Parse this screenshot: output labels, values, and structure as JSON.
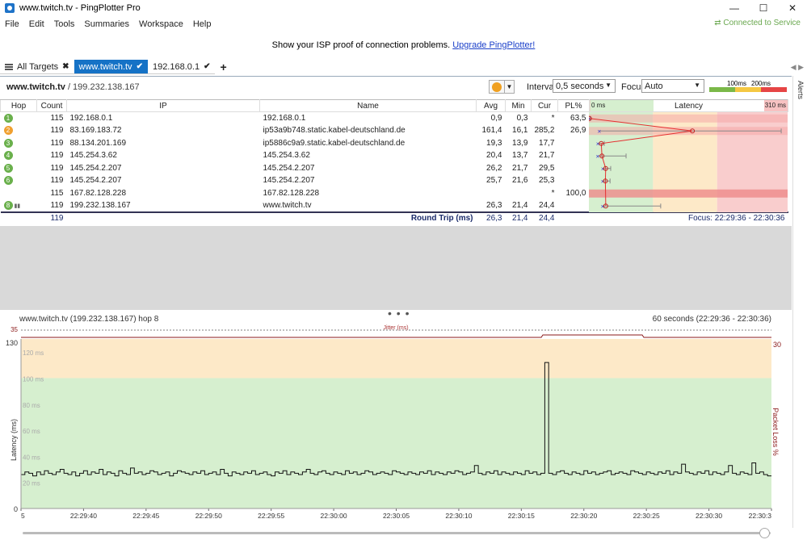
{
  "window": {
    "title": "www.twitch.tv - PingPlotter Pro"
  },
  "menu": [
    "File",
    "Edit",
    "Tools",
    "Summaries",
    "Workspace",
    "Help"
  ],
  "status": {
    "connected": "Connected to Service"
  },
  "promo": {
    "text": "Show your ISP proof of connection problems.",
    "link": "Upgrade PingPlotter!"
  },
  "tabs": [
    {
      "label": "All Targets",
      "mark": "✖"
    },
    {
      "label": "www.twitch.tv",
      "mark": "✔"
    },
    {
      "label": "192.168.0.1",
      "mark": "✔"
    }
  ],
  "target": {
    "name": "www.twitch.tv",
    "ip": " / 199.232.138.167"
  },
  "controls": {
    "interval_label": "Interval",
    "interval_value": "0,5 seconds",
    "focus_label": "Focus",
    "focus_value": "Auto",
    "legend_100": "100ms",
    "legend_200": "200ms",
    "alerts": "Alerts"
  },
  "columns": {
    "hop": "Hop",
    "count": "Count",
    "ip": "IP",
    "name": "Name",
    "avg": "Avg",
    "min": "Min",
    "cur": "Cur",
    "pl": "PL%",
    "latency": "Latency",
    "lat_min": "0 ms",
    "lat_max": "310 ms"
  },
  "hops": [
    {
      "hop": "1",
      "color": "#6ab04c",
      "count": "115",
      "ip": "192.168.0.1",
      "name": "192.168.0.1",
      "avg": "0,9",
      "min": "0,3",
      "cur": "*",
      "pl": "63,5",
      "avg_ms": 0.9,
      "min_ms": 0.3,
      "max_ms": 2,
      "loss": 63.5
    },
    {
      "hop": "2",
      "color": "#f0a030",
      "count": "119",
      "ip": "83.169.183.72",
      "name": "ip53a9b748.static.kabel-deutschland.de",
      "avg": "161,4",
      "min": "16,1",
      "cur": "285,2",
      "pl": "26,9",
      "avg_ms": 161.4,
      "min_ms": 16.1,
      "max_ms": 300,
      "loss": 26.9
    },
    {
      "hop": "3",
      "color": "#6ab04c",
      "count": "119",
      "ip": "88.134.201.169",
      "name": "ip5886c9a9.static.kabel-deutschland.de",
      "avg": "19,3",
      "min": "13,9",
      "cur": "17,7",
      "pl": "",
      "avg_ms": 19.3,
      "min_ms": 13.9,
      "max_ms": 24,
      "loss": 0
    },
    {
      "hop": "4",
      "color": "#6ab04c",
      "count": "119",
      "ip": "145.254.3.62",
      "name": "145.254.3.62",
      "avg": "20,4",
      "min": "13,7",
      "cur": "21,7",
      "pl": "",
      "avg_ms": 20.4,
      "min_ms": 13.7,
      "max_ms": 58,
      "loss": 0
    },
    {
      "hop": "5",
      "color": "#6ab04c",
      "count": "119",
      "ip": "145.254.2.207",
      "name": "145.254.2.207",
      "avg": "26,2",
      "min": "21,7",
      "cur": "29,5",
      "pl": "",
      "avg_ms": 26.2,
      "min_ms": 21.7,
      "max_ms": 34,
      "loss": 0
    },
    {
      "hop": "6",
      "color": "#6ab04c",
      "count": "119",
      "ip": "145.254.2.207",
      "name": "145.254.2.207",
      "avg": "25,7",
      "min": "21,6",
      "cur": "25,3",
      "pl": "",
      "avg_ms": 25.7,
      "min_ms": 21.6,
      "max_ms": 33,
      "loss": 0
    },
    {
      "hop": "",
      "color": "",
      "count": "115",
      "ip": "167.82.128.228",
      "name": "167.82.128.228",
      "avg": "",
      "min": "",
      "cur": "*",
      "pl": "100,0",
      "avg_ms": null,
      "min_ms": null,
      "max_ms": null,
      "loss": 100
    },
    {
      "hop": "8",
      "color": "#6ab04c",
      "count": "119",
      "ip": "199.232.138.167",
      "name": "www.twitch.tv",
      "avg": "26,3",
      "min": "21,4",
      "cur": "24,4",
      "pl": "",
      "avg_ms": 26.3,
      "min_ms": 21.4,
      "max_ms": 112,
      "loss": 0
    }
  ],
  "roundtrip": {
    "count": "119",
    "label": "Round Trip (ms)",
    "avg": "26,3",
    "min": "21,4",
    "cur": "24,4",
    "focus": "Focus: 22:29:36 - 22:30:36"
  },
  "graph": {
    "title": "www.twitch.tv (199.232.138.167) hop 8",
    "range": "60 seconds (22:29:36 - 22:30:36)",
    "jitter_label": "Jitter (ms)",
    "jitter_max": "35",
    "y_max": "130",
    "y_min": "0",
    "y_labels": [
      "120 ms",
      "100 ms",
      "80 ms",
      "60 ms",
      "40 ms",
      "20 ms"
    ],
    "y_axis_label": "Latency (ms)",
    "loss_axis_label": "Packet Loss %",
    "loss_max": "30",
    "x_labels": [
      "5",
      "22:29:40",
      "22:29:45",
      "22:29:50",
      "22:29:55",
      "22:30:00",
      "22:30:05",
      "22:30:10",
      "22:30:15",
      "22:30:20",
      "22:30:25",
      "22:30:30",
      "22:30:3"
    ]
  }
}
